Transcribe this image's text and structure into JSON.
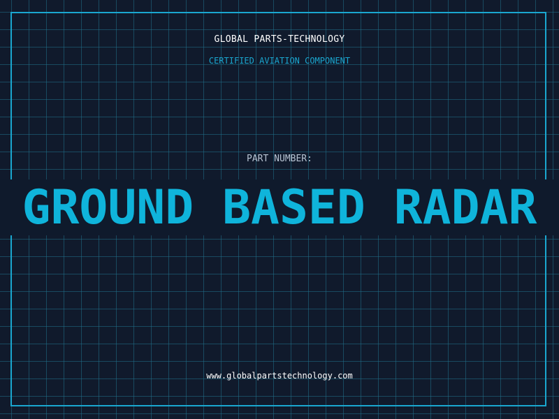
{
  "header": {
    "brand": "GLOBAL PARTS-TECHNOLOGY",
    "subtitle": "CERTIFIED AVIATION COMPONENT"
  },
  "part": {
    "label": "PART NUMBER:",
    "value": "GROUND BASED RADAR"
  },
  "footer": {
    "url": "www.globalpartstechnology.com"
  },
  "colors": {
    "background": "#101a2c",
    "accent": "#1aa7d0",
    "title": "#0fb4db",
    "text": "#ffffff",
    "muted": "#b8c4d3"
  }
}
